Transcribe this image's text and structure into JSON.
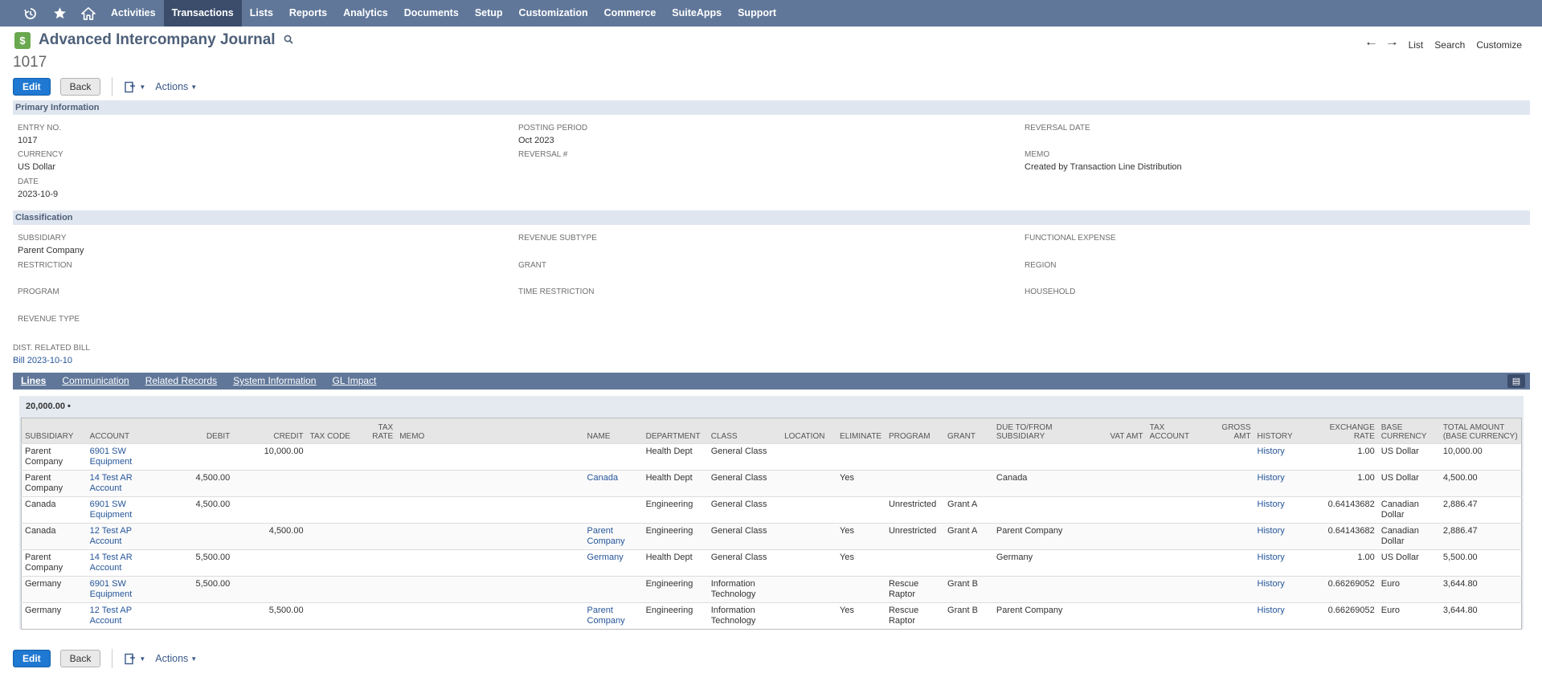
{
  "nav": {
    "items": [
      "Activities",
      "Transactions",
      "Lists",
      "Reports",
      "Analytics",
      "Documents",
      "Setup",
      "Customization",
      "Commerce",
      "SuiteApps",
      "Support"
    ],
    "active": "Transactions"
  },
  "header": {
    "title": "Advanced Intercompany Journal",
    "record_number": "1017",
    "links": {
      "list": "List",
      "search": "Search",
      "customize": "Customize"
    }
  },
  "actions": {
    "edit": "Edit",
    "back": "Back",
    "actions_menu": "Actions"
  },
  "primary": {
    "heading": "Primary Information",
    "entry_no_label": "ENTRY NO.",
    "entry_no": "1017",
    "currency_label": "CURRENCY",
    "currency": "US Dollar",
    "date_label": "DATE",
    "date": "2023-10-9",
    "posting_period_label": "POSTING PERIOD",
    "posting_period": "Oct 2023",
    "reversal_num_label": "REVERSAL #",
    "reversal_date_label": "REVERSAL DATE",
    "memo_label": "MEMO",
    "memo": "Created by Transaction Line Distribution"
  },
  "classification": {
    "heading": "Classification",
    "subsidiary_label": "SUBSIDIARY",
    "subsidiary": "Parent Company",
    "restriction_label": "RESTRICTION",
    "program_label": "PROGRAM",
    "revenue_type_label": "REVENUE TYPE",
    "revenue_subtype_label": "REVENUE SUBTYPE",
    "grant_label": "GRANT",
    "time_restriction_label": "TIME RESTRICTION",
    "functional_expense_label": "FUNCTIONAL EXPENSE",
    "region_label": "REGION",
    "household_label": "HOUSEHOLD"
  },
  "dist": {
    "label": "DIST. RELATED BILL",
    "value": "Bill 2023-10-10"
  },
  "subtabs": [
    "Lines",
    "Communication",
    "Related Records",
    "System Information",
    "GL Impact"
  ],
  "lines": {
    "total": "20,000.00 •",
    "columns": [
      "SUBSIDIARY",
      "ACCOUNT",
      "DEBIT",
      "CREDIT",
      "TAX CODE",
      "TAX RATE",
      "MEMO",
      "NAME",
      "DEPARTMENT",
      "CLASS",
      "LOCATION",
      "ELIMINATE",
      "PROGRAM",
      "GRANT",
      "DUE TO/FROM SUBSIDIARY",
      "VAT AMT",
      "TAX ACCOUNT",
      "GROSS AMT",
      "HISTORY",
      "EXCHANGE RATE",
      "BASE CURRENCY",
      "TOTAL AMOUNT (BASE CURRENCY)"
    ],
    "rows": [
      [
        "Parent Company",
        "6901 SW Equipment",
        "",
        "10,000.00",
        "",
        "",
        "",
        "",
        "Health Dept",
        "General Class",
        "",
        "",
        "",
        "",
        "",
        "",
        "",
        "",
        "History",
        "1.00",
        "US Dollar",
        "10,000.00"
      ],
      [
        "Parent Company",
        "14 Test AR Account",
        "4,500.00",
        "",
        "",
        "",
        "",
        "Canada",
        "Health Dept",
        "General Class",
        "",
        "Yes",
        "",
        "",
        "Canada",
        "",
        "",
        "",
        "History",
        "1.00",
        "US Dollar",
        "4,500.00"
      ],
      [
        "Canada",
        "6901 SW Equipment",
        "4,500.00",
        "",
        "",
        "",
        "",
        "",
        "Engineering",
        "General Class",
        "",
        "",
        "Unrestricted",
        "Grant A",
        "",
        "",
        "",
        "",
        "History",
        "0.64143682",
        "Canadian Dollar",
        "2,886.47"
      ],
      [
        "Canada",
        "12 Test AP Account",
        "",
        "4,500.00",
        "",
        "",
        "",
        "Parent Company",
        "Engineering",
        "General Class",
        "",
        "Yes",
        "Unrestricted",
        "Grant A",
        "Parent Company",
        "",
        "",
        "",
        "History",
        "0.64143682",
        "Canadian Dollar",
        "2,886.47"
      ],
      [
        "Parent Company",
        "14 Test AR Account",
        "5,500.00",
        "",
        "",
        "",
        "",
        "Germany",
        "Health Dept",
        "General Class",
        "",
        "Yes",
        "",
        "",
        "Germany",
        "",
        "",
        "",
        "History",
        "1.00",
        "US Dollar",
        "5,500.00"
      ],
      [
        "Germany",
        "6901 SW Equipment",
        "5,500.00",
        "",
        "",
        "",
        "",
        "",
        "Engineering",
        "Information Technology",
        "",
        "",
        "Rescue Raptor",
        "Grant B",
        "",
        "",
        "",
        "",
        "History",
        "0.66269052",
        "Euro",
        "3,644.80"
      ],
      [
        "Germany",
        "12 Test AP Account",
        "",
        "5,500.00",
        "",
        "",
        "",
        "Parent Company",
        "Engineering",
        "Information Technology",
        "",
        "Yes",
        "Rescue Raptor",
        "Grant B",
        "Parent Company",
        "",
        "",
        "",
        "History",
        "0.66269052",
        "Euro",
        "3,644.80"
      ]
    ]
  },
  "colors": {
    "nav_bg": "#607799",
    "nav_active": "#3b4d6b",
    "primary_button": "#1f78d1",
    "link": "#255599",
    "section_bar": "#e0e6ef"
  }
}
